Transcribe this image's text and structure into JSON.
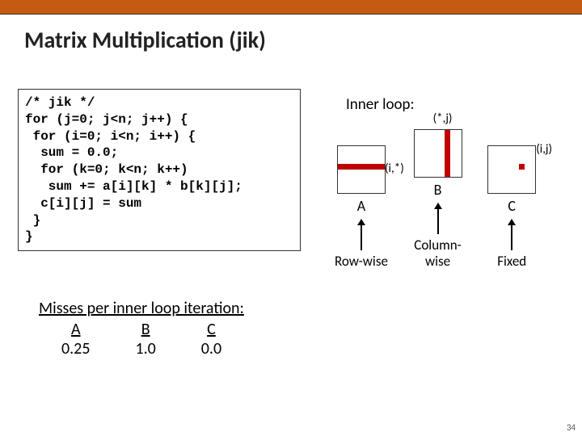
{
  "title": "Matrix Multiplication (jik)",
  "code": "/* jik */\nfor (j=0; j<n; j++) {\n for (i=0; i<n; i++) {\n  sum = 0.0;\n  for (k=0; k<n; k++)\n   sum += a[i][k] * b[k][j];\n  c[i][j] = sum\n }\n}",
  "inner_loop_label": "Inner loop:",
  "matrices": {
    "A": {
      "label": "A",
      "annotation": "(i,*)",
      "access": "Row-wise"
    },
    "B": {
      "label": "B",
      "annotation": "(*,j)",
      "access": "Column-\nwise"
    },
    "C": {
      "label": "C",
      "annotation": "(i,j)",
      "access": "Fixed"
    }
  },
  "misses": {
    "heading": "Misses per inner loop iteration:",
    "cols": [
      "A",
      "B",
      "C"
    ],
    "vals": [
      "0.25",
      "1.0",
      "0.0"
    ]
  },
  "page_number": "34"
}
